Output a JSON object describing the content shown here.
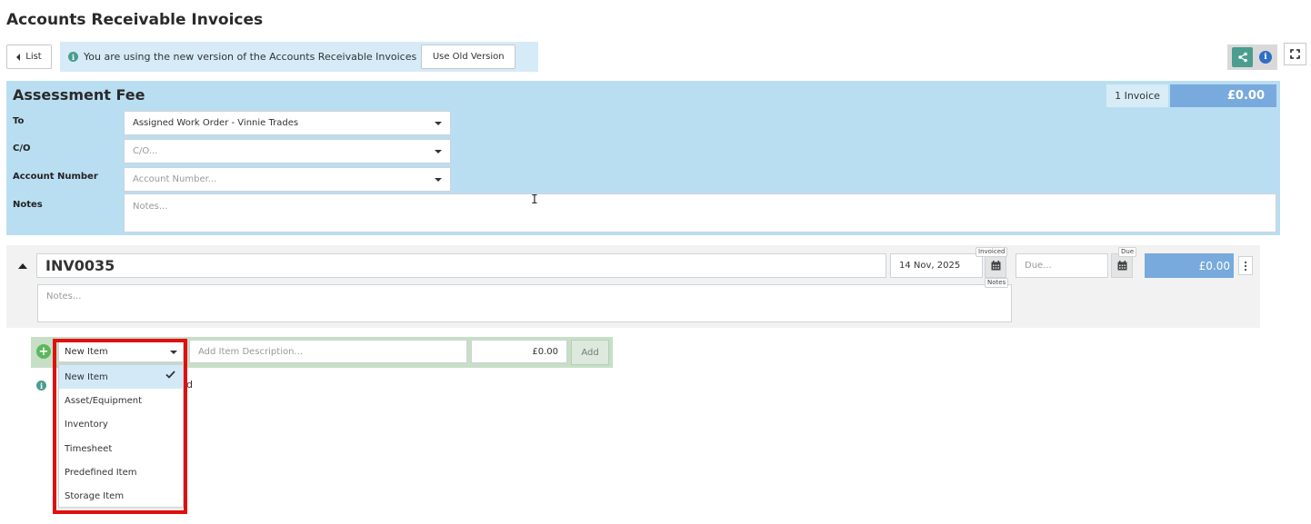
{
  "page": {
    "title": "Accounts Receivable Invoices"
  },
  "toolbar": {
    "list_label": "List",
    "notice_text": "You are using the new version of the Accounts Receivable Invoices",
    "old_version_label": "Use Old Version"
  },
  "group": {
    "title": "Assessment Fee",
    "invoice_count": "1 Invoice",
    "total": "£0.00",
    "fields": {
      "to_label": "To",
      "to_value": "Assigned Work Order - Vinnie Trades",
      "co_label": "C/O",
      "co_placeholder": "C/O...",
      "account_label": "Account Number",
      "account_placeholder": "Account Number...",
      "notes_label": "Notes",
      "notes_placeholder": "Notes..."
    }
  },
  "invoice": {
    "number": "INV0035",
    "invoiced_date": "14 Nov, 2025",
    "invoiced_tag": "Invoiced",
    "due_placeholder": "Due...",
    "due_tag": "Due",
    "total": "£0.00",
    "notes_placeholder": "Notes...",
    "notes_tag": "Notes"
  },
  "add_item": {
    "type_value": "New Item",
    "description_placeholder": "Add Item Description...",
    "price": "£0.00",
    "add_label": "Add",
    "hint_visible_tail": "d"
  },
  "item_type_options": [
    {
      "label": "New Item",
      "selected": true
    },
    {
      "label": "Asset/Equipment",
      "selected": false
    },
    {
      "label": "Inventory",
      "selected": false
    },
    {
      "label": "Timesheet",
      "selected": false
    },
    {
      "label": "Predefined Item",
      "selected": false
    },
    {
      "label": "Storage Item",
      "selected": false
    }
  ],
  "colors": {
    "panel_blue": "#b9def2",
    "total_blue": "#78aadd",
    "accent_teal": "#4a9d8f",
    "add_bar_green": "#c6dfc6",
    "highlight_red": "#e01010"
  }
}
